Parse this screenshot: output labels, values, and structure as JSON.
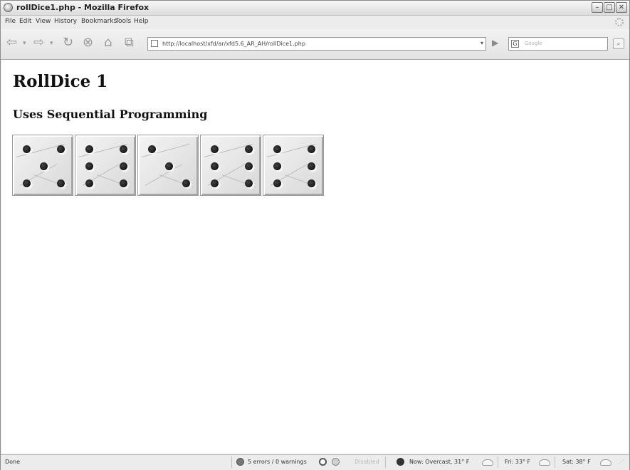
{
  "window": {
    "title": "rollDice1.php - Mozilla Firefox"
  },
  "menu": [
    "File",
    "Edit",
    "View",
    "History",
    "Bookmarks",
    "Tools",
    "Help"
  ],
  "nav": {
    "url": "http://localhost/xfd/ar/xfd5.6_AR_AH/rollDice1.php",
    "search_placeholder": "Google"
  },
  "page": {
    "heading": "RollDice 1",
    "subheading": "Uses Sequential Programming",
    "dice": [
      5,
      6,
      3,
      6,
      6
    ]
  },
  "status": {
    "text": "Done",
    "errors": "5 errors / 0 warnings",
    "disabled": "Disabled",
    "weather_now": "Now: Overcast, 31° F",
    "weather_fri": "Fri: 33° F",
    "weather_sat": "Sat: 38° F"
  }
}
